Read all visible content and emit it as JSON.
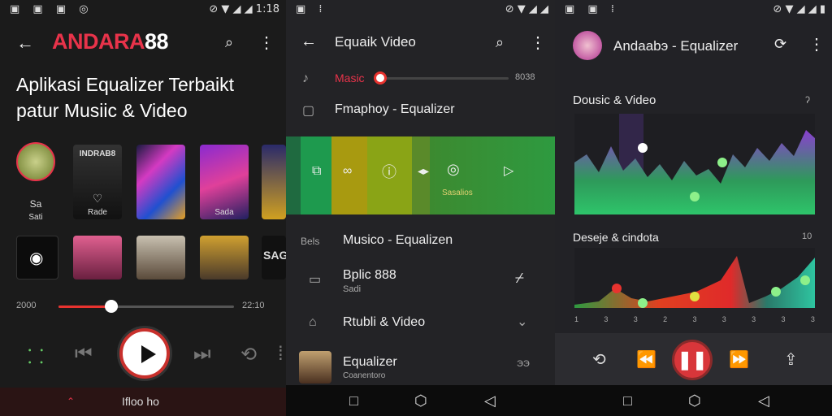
{
  "panels": {
    "p1": {
      "status_right": "1:18",
      "brand_red": "ANDARA",
      "brand_white": "88",
      "headline": "Aplikasi Equalizer Terbaikt patur Musiic & Video",
      "tiles_row1": [
        {
          "label": "Sa",
          "sub": "Sati"
        },
        {
          "label": "INDRAB8",
          "sub": "Rade"
        },
        {
          "label": "",
          "sub": ""
        },
        {
          "label": "",
          "sub": "Sada"
        },
        {
          "label": "",
          "sub": ""
        }
      ],
      "tile_row2_label": "SAGA",
      "time_start": "2000",
      "time_end": "22:10",
      "progress": 0.3,
      "bottom_label": "Ifloo ho"
    },
    "p2": {
      "title": "Equaik Video",
      "music_label": "Masic",
      "music_value": "8038",
      "music_level": 0.05,
      "row2": "Fmaphoy - Equalizer",
      "banner_caption": "Sasalios",
      "section_prefix": "Bels",
      "section_title": "Musico - Equalizen",
      "item1_title": "Bplic 888",
      "item1_sub": "Sadi",
      "item2_title": "Rtubli & Video",
      "item3_title": "Equalizer",
      "item3_sub": "Coanentoro",
      "item3_meta": "ЭЭ"
    },
    "p3": {
      "title": "Andaabэ - Equalizer",
      "chart1_title": "Dousic & Video",
      "chart2_title": "Deseje & cindota",
      "chart2_corner": "10",
      "axis_ticks": [
        "1",
        "3",
        "3",
        "2",
        "3",
        "3",
        "3",
        "3",
        "3"
      ]
    }
  },
  "colors": {
    "accent_red": "#e8334a",
    "play_red": "#d8363a",
    "eq_green": "#2ec46a",
    "eq_purple": "#8a3fd0"
  }
}
